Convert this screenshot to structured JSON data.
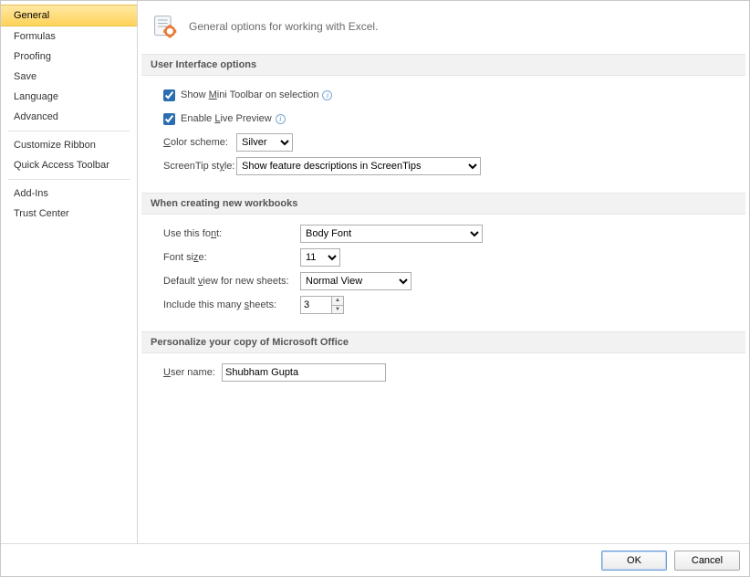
{
  "sidebar": {
    "items": [
      {
        "label": "General",
        "active": true
      },
      {
        "label": "Formulas",
        "active": false
      },
      {
        "label": "Proofing",
        "active": false
      },
      {
        "label": "Save",
        "active": false
      },
      {
        "label": "Language",
        "active": false
      },
      {
        "label": "Advanced",
        "active": false
      }
    ],
    "items2": [
      {
        "label": "Customize Ribbon"
      },
      {
        "label": "Quick Access Toolbar"
      }
    ],
    "items3": [
      {
        "label": "Add-Ins"
      },
      {
        "label": "Trust Center"
      }
    ]
  },
  "header": {
    "title": "General options for working with Excel."
  },
  "sections": {
    "ui": {
      "title": "User Interface options",
      "mini_toolbar_pre": "Show ",
      "mini_toolbar_u": "M",
      "mini_toolbar_post": "ini Toolbar on selection",
      "mini_toolbar_checked": true,
      "live_preview_pre": "Enable ",
      "live_preview_u": "L",
      "live_preview_post": "ive Preview",
      "live_preview_checked": true,
      "color_scheme_u": "C",
      "color_scheme_post": "olor scheme:",
      "color_scheme_value": "Silver",
      "screentip_pre": "ScreenTip st",
      "screentip_u": "y",
      "screentip_post": "le:",
      "screentip_value": "Show feature descriptions in ScreenTips"
    },
    "newwb": {
      "title": "When creating new workbooks",
      "use_font_pre": "Use this fo",
      "use_font_u": "n",
      "use_font_post": "t:",
      "use_font_value": "Body Font",
      "font_size_pre": "Font si",
      "font_size_u": "z",
      "font_size_post": "e:",
      "font_size_value": "11",
      "default_view_pre": "Default ",
      "default_view_u": "v",
      "default_view_post": "iew for new sheets:",
      "default_view_value": "Normal View",
      "sheets_pre": "Include this many ",
      "sheets_u": "s",
      "sheets_post": "heets:",
      "sheets_value": "3"
    },
    "personalize": {
      "title": "Personalize your copy of Microsoft Office",
      "username_u": "U",
      "username_post": "ser name:",
      "username_value": "Shubham Gupta"
    }
  },
  "footer": {
    "ok": "OK",
    "cancel": "Cancel"
  }
}
